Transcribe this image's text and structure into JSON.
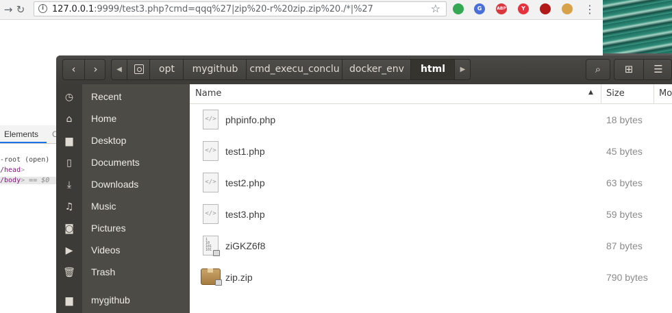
{
  "browser": {
    "url_host": "127.0.0.1",
    "url_rest": ":9999/test3.php?cmd=qqq%27|zip%20-r%20zip.zip%20./*|%27",
    "extensions": [
      {
        "name": "green-circle-extension",
        "label": "",
        "color": "#34a853"
      },
      {
        "name": "translate-extension",
        "label": "G",
        "color": "#4a6fd8"
      },
      {
        "name": "adblock-extension",
        "label": "ABP",
        "color": "#d9373e"
      },
      {
        "name": "red-shield-extension",
        "label": "Y",
        "color": "#e5333d"
      },
      {
        "name": "spider-extension",
        "label": "",
        "color": "#b21a1a"
      },
      {
        "name": "cookie-extension",
        "label": "",
        "color": "#d8a24a"
      }
    ]
  },
  "devtools": {
    "tab_active": "Elements",
    "tab_next": "C",
    "lines": [
      {
        "text": "-root (open)"
      },
      {
        "text": "/head"
      },
      {
        "text": "/body"
      }
    ],
    "selected_suffix": "== $0"
  },
  "file_manager": {
    "breadcrumbs": [
      "opt",
      "mygithub",
      "cmd_execu_conclu",
      "docker_env",
      "html"
    ],
    "active_crumb": "html",
    "sidebar": [
      {
        "label": "Recent",
        "icon": "recent-clock-icon"
      },
      {
        "label": "Home",
        "icon": "home-icon"
      },
      {
        "label": "Desktop",
        "icon": "desktop-folder-icon"
      },
      {
        "label": "Documents",
        "icon": "document-icon"
      },
      {
        "label": "Downloads",
        "icon": "download-arrow-icon"
      },
      {
        "label": "Music",
        "icon": "music-note-icon"
      },
      {
        "label": "Pictures",
        "icon": "camera-icon"
      },
      {
        "label": "Videos",
        "icon": "video-icon"
      },
      {
        "label": "Trash",
        "icon": "trash-icon"
      },
      {
        "label": "mygithub",
        "icon": "folder-icon"
      }
    ],
    "columns": {
      "name": "Name",
      "size": "Size",
      "modified": "Mo"
    },
    "files": [
      {
        "name": "phpinfo.php",
        "size": "18 bytes",
        "type": "code"
      },
      {
        "name": "test1.php",
        "size": "45 bytes",
        "type": "code"
      },
      {
        "name": "test2.php",
        "size": "63 bytes",
        "type": "code"
      },
      {
        "name": "test3.php",
        "size": "59 bytes",
        "type": "code"
      },
      {
        "name": "ziGKZ6f8",
        "size": "87 bytes",
        "type": "binary"
      },
      {
        "name": "zip.zip",
        "size": "790 bytes",
        "type": "archive"
      }
    ]
  }
}
